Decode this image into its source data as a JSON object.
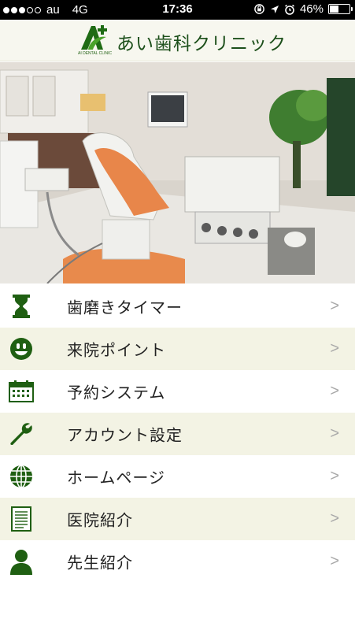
{
  "status_bar": {
    "carrier": "au",
    "network": "4G",
    "time": "17:36",
    "battery": "46%",
    "battery_level": 0.46
  },
  "header": {
    "clinic_name": "あい歯科クリニック",
    "logo_subtext": "AI DENTAL CLINIC"
  },
  "menu": {
    "items": [
      {
        "label": "歯磨きタイマー",
        "icon": "hourglass-icon",
        "chevron": ">"
      },
      {
        "label": "来院ポイント",
        "icon": "smiley-icon",
        "chevron": ">"
      },
      {
        "label": "予約システム",
        "icon": "calendar-icon",
        "chevron": ">"
      },
      {
        "label": "アカウント設定",
        "icon": "wrench-icon",
        "chevron": ">"
      },
      {
        "label": "ホームページ",
        "icon": "globe-icon",
        "chevron": ">"
      },
      {
        "label": "医院紹介",
        "icon": "document-icon",
        "chevron": ">"
      },
      {
        "label": "先生紹介",
        "icon": "person-icon",
        "chevron": ">"
      }
    ]
  },
  "colors": {
    "brand_green": "#1c4f1a",
    "header_bg": "#f7f7ef",
    "row_alt_bg": "#f3f3e4",
    "chevron": "#a8a8a8"
  }
}
